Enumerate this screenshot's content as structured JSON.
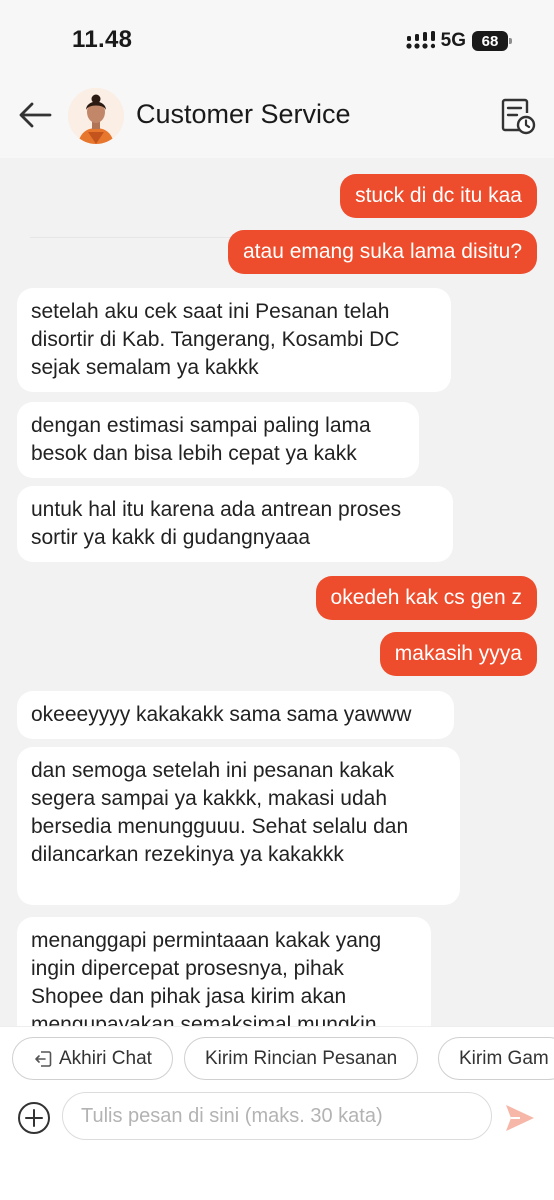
{
  "status_bar": {
    "time": "11.48",
    "network": "5G",
    "battery": "68"
  },
  "header": {
    "title": "Customer Service",
    "back_icon": "arrow-left-icon",
    "history_icon": "order-history-icon"
  },
  "messages": [
    {
      "side": "out",
      "text": "stuck di dc itu kaa"
    },
    {
      "side": "out",
      "text": "atau emang suka lama disitu?"
    },
    {
      "side": "in",
      "text": "setelah aku cek saat ini Pesanan telah disortir di Kab. Tangerang, Kosambi DC sejak semalam ya kakkk"
    },
    {
      "side": "in",
      "text": "dengan estimasi sampai paling lama besok dan bisa lebih cepat ya kakk"
    },
    {
      "side": "in",
      "text": "untuk hal itu karena ada antrean proses sortir ya kakk di gudangnyaaa"
    },
    {
      "side": "out",
      "text": "okedeh kak cs gen z"
    },
    {
      "side": "out",
      "text": "makasih yyya"
    },
    {
      "side": "in",
      "text": "okeeeyyyy kakakakk sama sama yawww"
    },
    {
      "side": "in",
      "text": "dan semoga setelah ini pesanan kakak segera sampai ya kakkk, makasi udah bersedia menungguuu. Sehat selalu dan dilancarkan rezekinya ya kakakkk"
    },
    {
      "side": "in",
      "text": "menanggapi permintaaan kakak yang ingin dipercepat prosesnya, pihak Shopee dan pihak jasa kirim akan mengupayakan semaksimal mungkin"
    }
  ],
  "quick_replies": [
    "Akhiri Chat",
    "Kirim Rincian Pesanan",
    "Kirim Gam"
  ],
  "input": {
    "placeholder": "Tulis pesan di sini (maks. 30 kata)"
  },
  "colors": {
    "accent": "#ee4d2d",
    "send_disabled": "#f6b7a8",
    "background": "#f2f2f2"
  }
}
